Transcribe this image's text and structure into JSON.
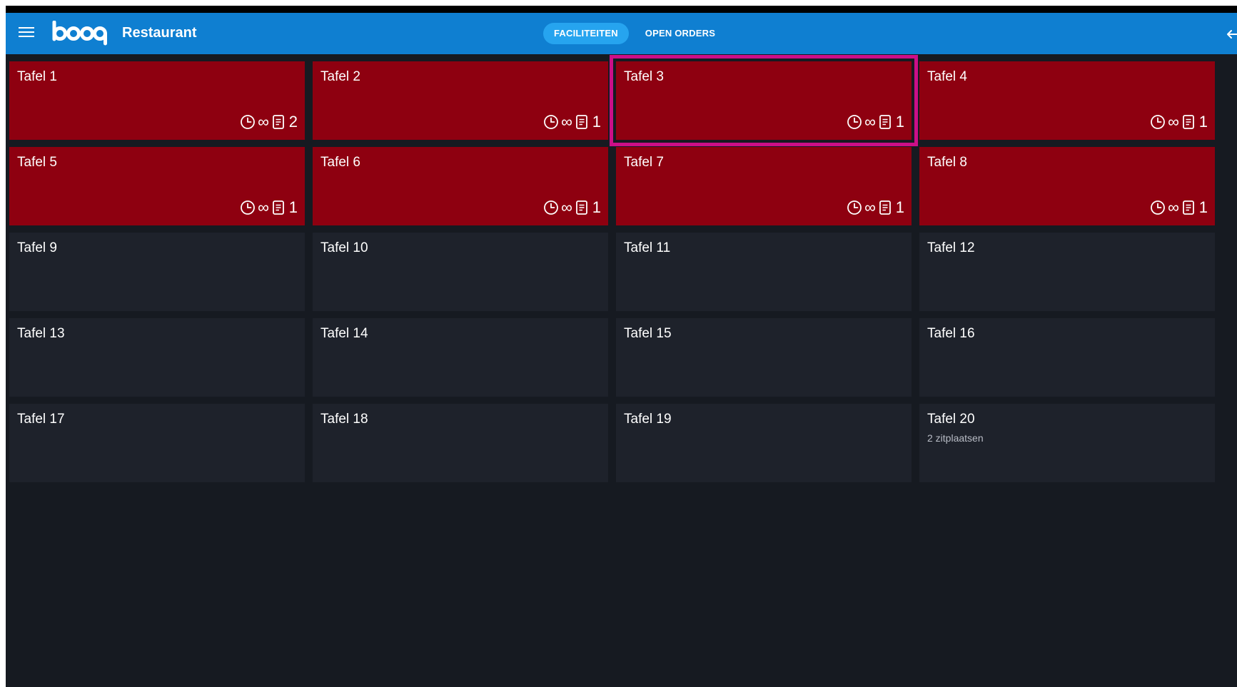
{
  "header": {
    "brand": "booq",
    "venue": "Restaurant",
    "tabs": [
      {
        "label": "FACILITEITEN",
        "active": true
      },
      {
        "label": "OPEN ORDERS",
        "active": false
      }
    ]
  },
  "colors": {
    "topbar": "#0f7fd1",
    "active_tab": "#26a4ef",
    "occupied": "#8e0010",
    "free": "#1e222b",
    "background": "#161a21",
    "selection": "#cc0f88"
  },
  "tables": [
    {
      "name": "Tafel 1",
      "occupied": true,
      "time": "∞",
      "orders": "2",
      "selected": false
    },
    {
      "name": "Tafel 2",
      "occupied": true,
      "time": "∞",
      "orders": "1",
      "selected": false
    },
    {
      "name": "Tafel 3",
      "occupied": true,
      "time": "∞",
      "orders": "1",
      "selected": true
    },
    {
      "name": "Tafel 4",
      "occupied": true,
      "time": "∞",
      "orders": "1",
      "selected": false
    },
    {
      "name": "Tafel 5",
      "occupied": true,
      "time": "∞",
      "orders": "1",
      "selected": false
    },
    {
      "name": "Tafel 6",
      "occupied": true,
      "time": "∞",
      "orders": "1",
      "selected": false
    },
    {
      "name": "Tafel 7",
      "occupied": true,
      "time": "∞",
      "orders": "1",
      "selected": false
    },
    {
      "name": "Tafel 8",
      "occupied": true,
      "time": "∞",
      "orders": "1",
      "selected": false
    },
    {
      "name": "Tafel 9",
      "occupied": false
    },
    {
      "name": "Tafel 10",
      "occupied": false
    },
    {
      "name": "Tafel 11",
      "occupied": false
    },
    {
      "name": "Tafel 12",
      "occupied": false
    },
    {
      "name": "Tafel 13",
      "occupied": false
    },
    {
      "name": "Tafel 14",
      "occupied": false
    },
    {
      "name": "Tafel 15",
      "occupied": false
    },
    {
      "name": "Tafel 16",
      "occupied": false
    },
    {
      "name": "Tafel 17",
      "occupied": false
    },
    {
      "name": "Tafel 18",
      "occupied": false
    },
    {
      "name": "Tafel 19",
      "occupied": false
    },
    {
      "name": "Tafel 20",
      "occupied": false,
      "seats": "2 zitplaatsen"
    }
  ]
}
